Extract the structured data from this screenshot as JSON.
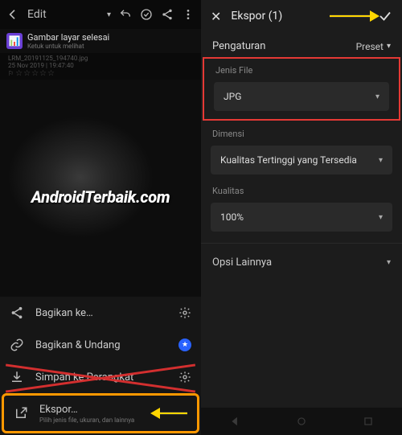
{
  "left": {
    "back_label": "Edit",
    "notif": {
      "title": "Gambar layar selesai",
      "subtitle": "Ketuk untuk melihat"
    },
    "meta": {
      "filename": "LRM_20191125_194740.jpg",
      "datetime": "25 Nov 2019 | 19:47:40",
      "flag": "⚐",
      "stars": "☆☆☆☆☆"
    },
    "watermark": "AndroidTerbaik.com",
    "share": {
      "bagikan_ke": "Bagikan ke…",
      "bagikan_undang": "Bagikan & Undang",
      "simpan": "Simpan ke Perangkat",
      "ekspor": "Ekspor…",
      "ekspor_sub": "Pilih jenis file, ukuran, dan lainnya"
    }
  },
  "right": {
    "title": "Ekspor (1)",
    "pengaturan": "Pengaturan",
    "preset": "Preset",
    "jenis_file_label": "Jenis File",
    "jenis_file_value": "JPG",
    "dimensi_label": "Dimensi",
    "dimensi_value": "Kualitas Tertinggi yang Tersedia",
    "kualitas_label": "Kualitas",
    "kualitas_value": "100%",
    "opsi_lainnya": "Opsi Lainnya"
  }
}
